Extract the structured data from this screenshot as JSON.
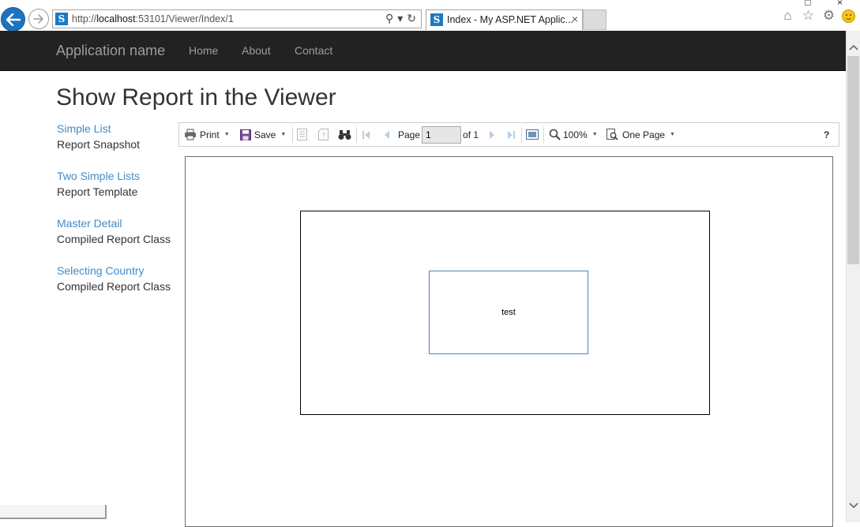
{
  "browser": {
    "url_prefix": "http://",
    "url_host": "localhost",
    "url_rest": ":53101/Viewer/Index/1",
    "tab_title": "Index - My ASP.NET Applic...",
    "tab_close": "×",
    "site_icon": "S",
    "search_glyph": "⚲",
    "dropdown_glyph": "▾",
    "refresh_glyph": "↻",
    "home_glyph": "⌂",
    "star_glyph": "☆",
    "gear_glyph": "⚙",
    "minimize_glyph": "□",
    "close_glyph": "×"
  },
  "navbar": {
    "brand": "Application name",
    "links": [
      "Home",
      "About",
      "Contact"
    ]
  },
  "page": {
    "title": "Show Report in the Viewer"
  },
  "sidebar": {
    "items": [
      {
        "link": "Simple List",
        "desc": "Report Snapshot"
      },
      {
        "link": "Two Simple Lists",
        "desc": "Report Template"
      },
      {
        "link": "Master Detail",
        "desc": "Compiled Report Class"
      },
      {
        "link": "Selecting Country",
        "desc": "Compiled Report Class"
      }
    ]
  },
  "toolbar": {
    "print_label": "Print",
    "save_label": "Save",
    "page_label": "Page",
    "page_value": "1",
    "page_of": "of 1",
    "zoom_label": "100%",
    "view_mode_label": "One Page",
    "help_label": "?"
  },
  "report": {
    "textbox_text": "test"
  },
  "colors": {
    "navbar_bg": "#222222",
    "link": "#428bca",
    "textbox_border": "#4f81bd"
  }
}
